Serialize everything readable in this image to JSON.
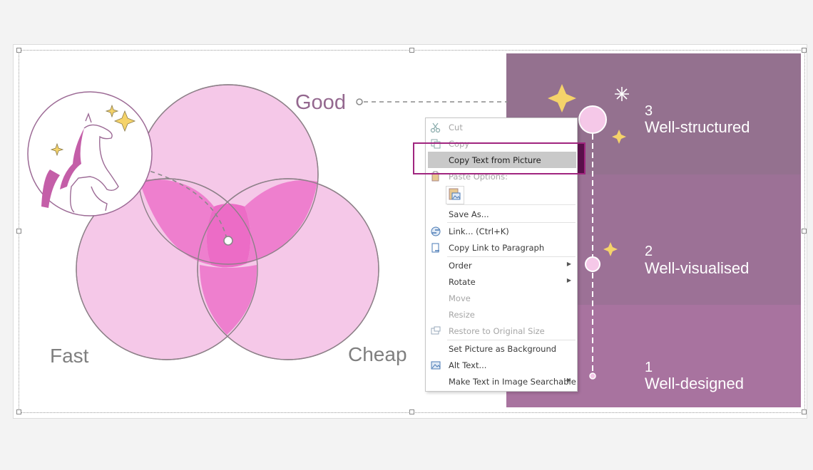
{
  "diagram": {
    "labels": {
      "good": "Good",
      "fast": "Fast",
      "cheap": "Cheap"
    },
    "levels": [
      {
        "number": "3",
        "text": "Well-structured"
      },
      {
        "number": "2",
        "text": "Well-visualised"
      },
      {
        "number": "1",
        "text": "Well-designed"
      }
    ],
    "colors": {
      "panel_top": "#94718f",
      "panel_mid": "#9c7196",
      "panel_bottom": "#a8739f",
      "circle_fill": "#f5c8e8",
      "overlap_fill": "#ee7fce",
      "label_purple": "#94688f",
      "label_gray": "#7f7f7f",
      "star_yellow": "#f5d36a"
    }
  },
  "context_menu": {
    "items": [
      {
        "label": "Cut",
        "icon": "scissors-icon",
        "disabled": true
      },
      {
        "label": "Copy",
        "icon": "copy-icon",
        "disabled": true
      },
      {
        "label": "Copy Text from Picture",
        "icon": "",
        "disabled": false,
        "highlighted": true
      },
      {
        "label": "Paste Options:",
        "icon": "clipboard-icon",
        "disabled": true
      },
      {
        "label": "Save As...",
        "icon": "",
        "disabled": false
      },
      {
        "label": "Link...  (Ctrl+K)",
        "icon": "link-icon",
        "disabled": false
      },
      {
        "label": "Copy Link to Paragraph",
        "icon": "link-paragraph-icon",
        "disabled": false
      },
      {
        "label": "Order",
        "icon": "",
        "disabled": false,
        "submenu": true
      },
      {
        "label": "Rotate",
        "icon": "",
        "disabled": false,
        "submenu": true
      },
      {
        "label": "Move",
        "icon": "",
        "disabled": true
      },
      {
        "label": "Resize",
        "icon": "",
        "disabled": true
      },
      {
        "label": "Restore to Original Size",
        "icon": "restore-size-icon",
        "disabled": true
      },
      {
        "label": "Set Picture as Background",
        "icon": "",
        "disabled": false
      },
      {
        "label": "Alt Text...",
        "icon": "alt-text-icon",
        "disabled": false
      },
      {
        "label": "Make Text in Image Searchable",
        "icon": "",
        "disabled": false,
        "submenu": true
      }
    ]
  }
}
